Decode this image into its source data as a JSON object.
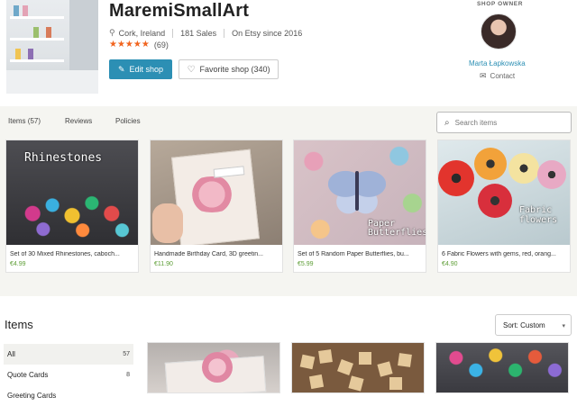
{
  "shop": {
    "name": "MaremiSmallArt",
    "location": "Cork, Ireland",
    "sales": "181 Sales",
    "since": "On Etsy since 2016",
    "stars": "★★★★★",
    "review_count": "(69)",
    "edit_label": "Edit shop",
    "favorite_label": "Favorite shop (340)"
  },
  "owner": {
    "label": "SHOP OWNER",
    "name": "Marta Łapkowska",
    "contact_label": "Contact"
  },
  "tabs": [
    "Items (57)",
    "Reviews",
    "Policies"
  ],
  "search": {
    "placeholder": "Search items"
  },
  "featured": [
    {
      "title": "Set of 30 Mixed Rhinestones, caboch...",
      "price": "€4.99",
      "overlay": "Rhinestones"
    },
    {
      "title": "Handmade Birthday Card, 3D greetin...",
      "price": "€11.90",
      "overlay": ""
    },
    {
      "title": "Set of 5 Random Paper Butterflies, bu...",
      "price": "€5.99",
      "overlay": "Paper Butterflies"
    },
    {
      "title": "6 Fabric Flowers with gems, red, orang...",
      "price": "€4.90",
      "overlay": "Fabric flowers"
    }
  ],
  "items_section": {
    "heading": "Items",
    "sort_label": "Sort: Custom",
    "categories": [
      {
        "label": "All",
        "count": "57",
        "active": true
      },
      {
        "label": "Quote Cards",
        "count": "8",
        "active": false
      },
      {
        "label": "Greeting Cards",
        "count": "",
        "active": false
      }
    ]
  },
  "colors": {
    "accent": "#2c8fb4",
    "star": "#f1641e",
    "price": "#5c9d34",
    "band": "#f5f5f1"
  },
  "icons": {
    "location": "map-pin-icon",
    "edit": "pencil-icon",
    "favorite": "heart-icon",
    "contact": "envelope-icon",
    "search": "search-icon",
    "sort": "chevron-down-icon"
  }
}
